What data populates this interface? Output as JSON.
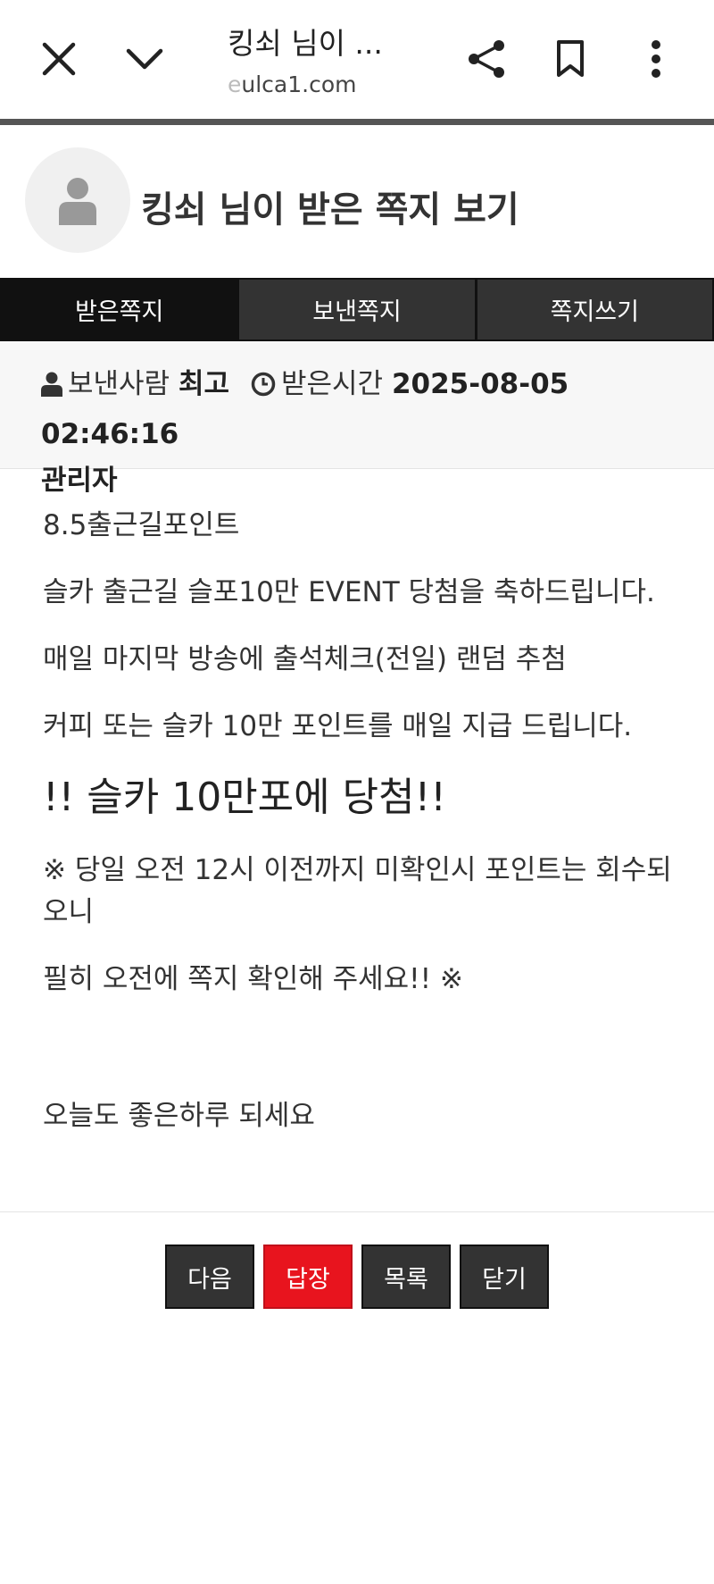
{
  "browser": {
    "title": "킹쇠 님이 ...",
    "url_faded": "e",
    "url": "ulca1.com"
  },
  "page": {
    "title": "킹쇠 님이 받은 쪽지 보기"
  },
  "tabs": [
    {
      "label": "받은쪽지",
      "active": true
    },
    {
      "label": "보낸쪽지",
      "active": false
    },
    {
      "label": "쪽지쓰기",
      "active": false
    }
  ],
  "info": {
    "sender_label": "보낸사람",
    "sender_value_line1": "최고",
    "sender_value_line2": "관리자",
    "time_label": "받은시간",
    "time_value": "2025-08-05 02:46:16"
  },
  "message": {
    "line1": "8.5출근길포인트",
    "line2": "슬카 출근길 슬포10만 EVENT 당첨을 축하드립니다.",
    "line3": "매일 마지막 방송에 출석체크(전일) 랜덤 추첨",
    "line4": "커피 또는 슬카 10만 포인트를 매일 지급 드립니다.",
    "headline": "!! 슬카 10만포에 당첨!!",
    "notice1": "※ 당일 오전 12시 이전까지 미확인시 포인트는 회수되오니",
    "notice2": "필히 오전에 쪽지 확인해 주세요!! ※",
    "closing": "오늘도 좋은하루 되세요"
  },
  "buttons": {
    "next": "다음",
    "reply": "답장",
    "list": "목록",
    "close": "닫기"
  },
  "colors": {
    "reply_button": "#e8141e",
    "tab_active": "#111111",
    "tab_inactive": "#333333"
  }
}
